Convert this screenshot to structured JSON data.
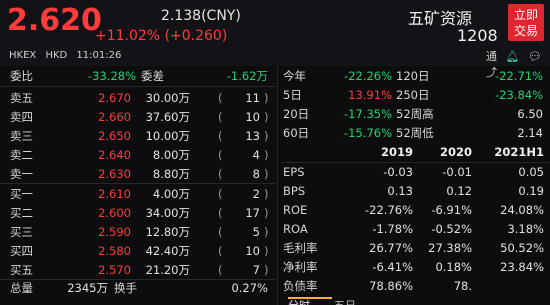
{
  "quote": {
    "price": "2.620",
    "cny": "2.138(CNY)",
    "change": "+11.02% (+0.260)",
    "exchange": "HKEX",
    "currency": "HKD",
    "time": "11:01:26",
    "name": "五矿资源",
    "code": "1208",
    "trade_button": [
      "立即",
      "交易"
    ],
    "icons": [
      "通",
      "bell-icon",
      "chat-icon",
      "share-icon"
    ]
  },
  "order_book": {
    "summary": {
      "weibi_label": "委比",
      "weibi_value": "-33.28%",
      "weicha_label": "委差",
      "weicha_value": "-1.62万"
    },
    "asks": [
      {
        "label": "卖五",
        "price": "2.670",
        "volume": "30.00万",
        "orders": "11"
      },
      {
        "label": "卖四",
        "price": "2.660",
        "volume": "37.60万",
        "orders": "10"
      },
      {
        "label": "卖三",
        "price": "2.650",
        "volume": "10.00万",
        "orders": "13"
      },
      {
        "label": "卖二",
        "price": "2.640",
        "volume": "8.00万",
        "orders": "4"
      },
      {
        "label": "卖一",
        "price": "2.630",
        "volume": "8.80万",
        "orders": "8"
      }
    ],
    "bids": [
      {
        "label": "买一",
        "price": "2.610",
        "volume": "4.00万",
        "orders": "2"
      },
      {
        "label": "买二",
        "price": "2.600",
        "volume": "34.00万",
        "orders": "17"
      },
      {
        "label": "买三",
        "price": "2.590",
        "volume": "12.80万",
        "orders": "5"
      },
      {
        "label": "买四",
        "price": "2.580",
        "volume": "42.40万",
        "orders": "10"
      },
      {
        "label": "买五",
        "price": "2.570",
        "volume": "21.20万",
        "orders": "7"
      }
    ],
    "footer": {
      "vol_label": "总量",
      "vol_value": "2345万",
      "turnover_label": "换手",
      "turnover_value": "0.27%"
    }
  },
  "performance": [
    {
      "l1": "今年",
      "v1": "-22.26%",
      "c1": "green",
      "l2": "120日",
      "v2": "-22.71%",
      "c2": "green"
    },
    {
      "l1": "5日",
      "v1": "13.91%",
      "c1": "red",
      "l2": "250日",
      "v2": "-23.84%",
      "c2": "green"
    },
    {
      "l1": "20日",
      "v1": "-17.35%",
      "c1": "green",
      "l2": "52周高",
      "v2": "6.50",
      "c2": "white"
    },
    {
      "l1": "60日",
      "v1": "-15.76%",
      "c1": "green",
      "l2": "52周低",
      "v2": "2.14",
      "c2": "white"
    }
  ],
  "financials": {
    "years": [
      "2019",
      "2020",
      "2021H1"
    ],
    "rows": [
      {
        "label": "EPS",
        "values": [
          "-0.03",
          "-0.01",
          "0.05"
        ]
      },
      {
        "label": "BPS",
        "values": [
          "0.13",
          "0.12",
          "0.19"
        ]
      },
      {
        "label": "ROE",
        "values": [
          "-22.76%",
          "-6.91%",
          "24.08%"
        ]
      },
      {
        "label": "ROA",
        "values": [
          "-1.78%",
          "-0.52%",
          "3.18%"
        ]
      },
      {
        "label": "毛利率",
        "values": [
          "26.77%",
          "27.38%",
          "50.52%"
        ]
      },
      {
        "label": "净利率",
        "values": [
          "-6.41%",
          "0.18%",
          "23.84%"
        ]
      },
      {
        "label": "负债率",
        "values": [
          "78.86%",
          "78.",
          ""
        ]
      }
    ]
  },
  "tabs": [
    "分时",
    "五日"
  ],
  "colors": {
    "up": "#ff3b3b",
    "down": "#21d36b",
    "accent": "#e0262e",
    "tab_underline": "#ffb02e"
  }
}
